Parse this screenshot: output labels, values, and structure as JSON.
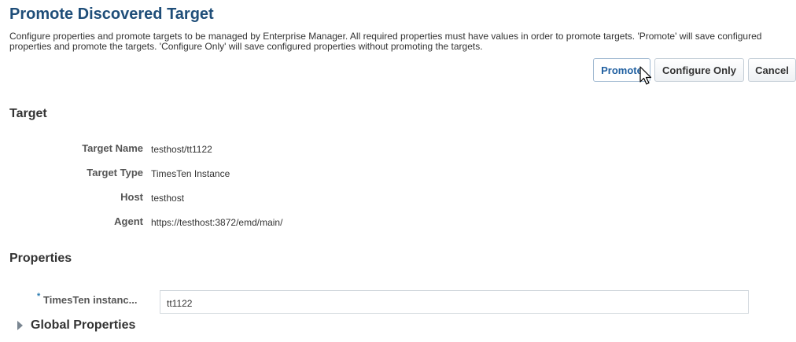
{
  "page": {
    "title": "Promote Discovered Target",
    "description": "Configure properties and promote targets to be managed by Enterprise Manager. All required properties must have values in order to promote targets. 'Promote' will save configured properties and promote the targets. 'Configure Only' will save configured properties without promoting the targets."
  },
  "toolbar": {
    "promote_label": "Promote",
    "configure_only_label": "Configure Only",
    "cancel_label": "Cancel"
  },
  "target_section": {
    "title": "Target",
    "rows": [
      {
        "label": "Target Name",
        "value": "testhost/tt1122"
      },
      {
        "label": "Target Type",
        "value": "TimesTen Instance"
      },
      {
        "label": "Host",
        "value": "testhost"
      },
      {
        "label": "Agent",
        "value": "https://testhost:3872/emd/main/"
      }
    ]
  },
  "properties_section": {
    "title": "Properties",
    "required_marker": "*",
    "field_label": "TimesTen instanc...",
    "field_value": "tt1122",
    "global_properties_label": "Global Properties"
  },
  "icons": {
    "cursor": "mouse-pointer-icon",
    "expand": "disclosure-triangle-icon"
  },
  "colors": {
    "title": "#1f4e79",
    "promote_text": "#1f5fa0",
    "required_star": "#2a7ab0"
  }
}
